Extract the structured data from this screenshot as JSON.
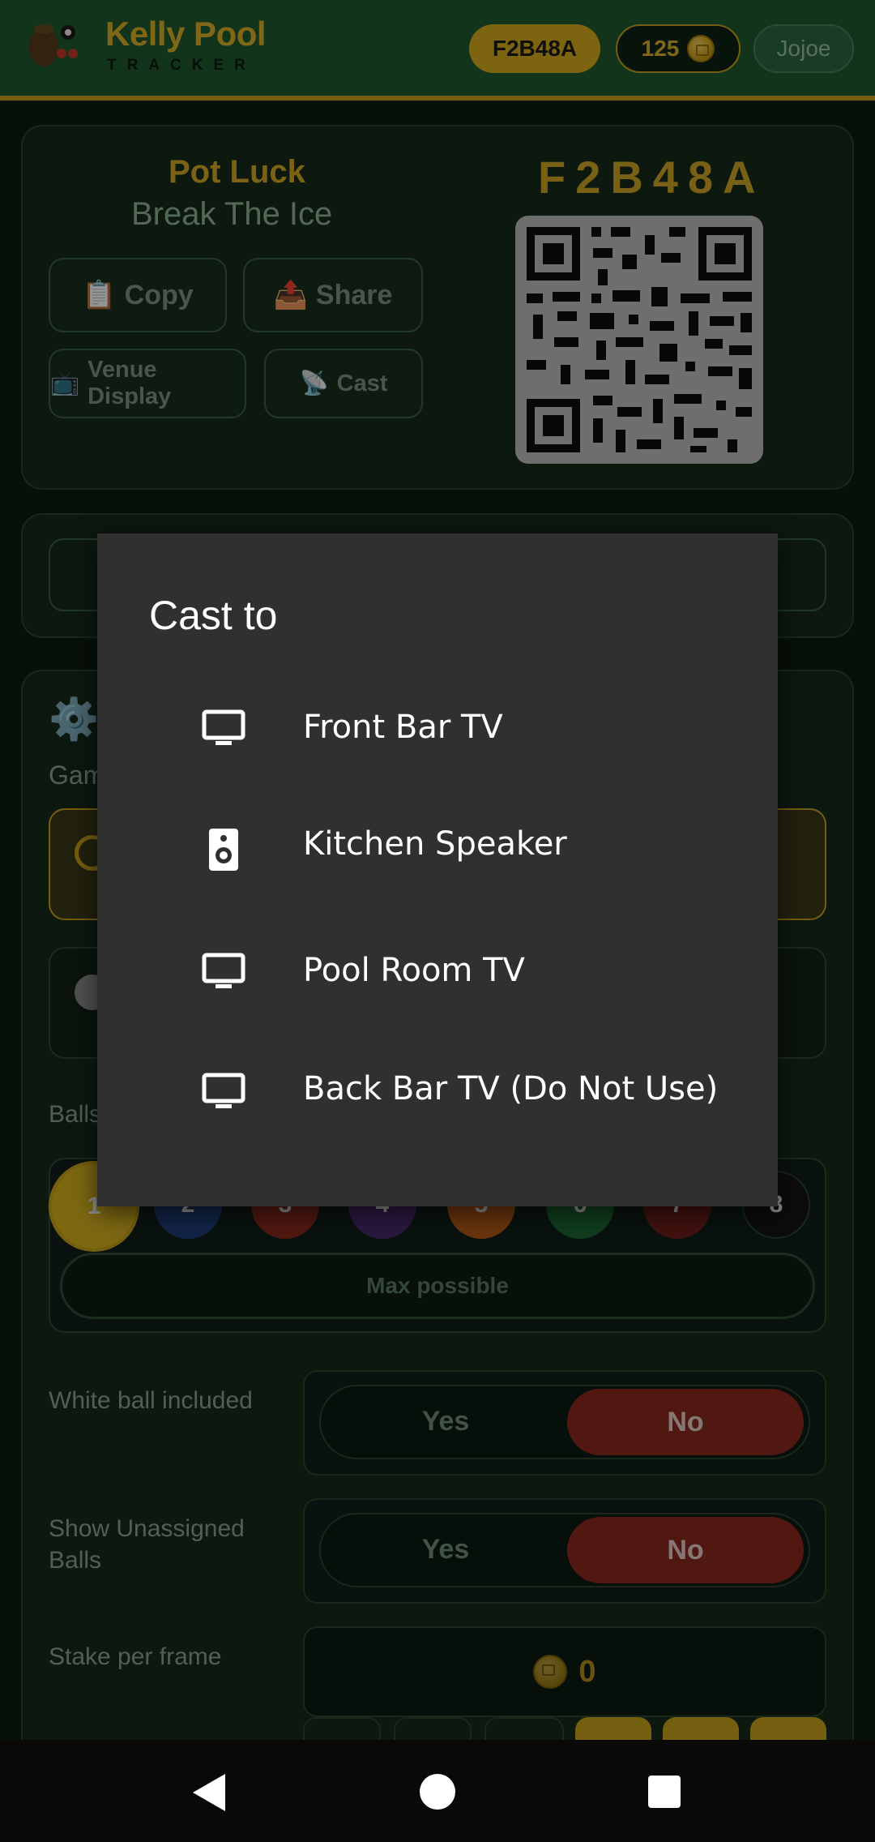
{
  "header": {
    "brand_name": "Kelly Pool",
    "brand_sub": "TRACKER",
    "game_code_pill": "F2B48A",
    "coins": "125",
    "user": "Jojoe"
  },
  "session": {
    "title": "Pot Luck",
    "subtitle": "Break The Ice",
    "copy_label": "Copy",
    "share_label": "Share",
    "venue_label": "Venue Display",
    "cast_label": "Cast",
    "room_code": "F2B48A",
    "icons": {
      "copy": "clipboard-icon",
      "share": "outbox-icon",
      "venue": "tv-icon",
      "cast": "satellite-icon"
    }
  },
  "settings": {
    "game_label_partial": "Gam",
    "balls_label_partial": "Balls",
    "balls": [
      {
        "num": "1",
        "color": "#d8b320"
      },
      {
        "num": "2",
        "color": "#1f3f7a"
      },
      {
        "num": "3",
        "color": "#8a2a1e"
      },
      {
        "num": "4",
        "color": "#4b2a6e"
      },
      {
        "num": "5",
        "color": "#b65a16"
      },
      {
        "num": "6",
        "color": "#1c6a32"
      },
      {
        "num": "7",
        "color": "#6e1f1a"
      },
      {
        "num": "8",
        "color": "#151515"
      }
    ],
    "max_possible": "Max possible",
    "white_ball_label": "White ball included",
    "white_ball_yes": "Yes",
    "white_ball_no": "No",
    "show_unassigned_label_1": "Show Unassigned",
    "show_unassigned_label_2": "Balls",
    "show_unassigned_yes": "Yes",
    "show_unassigned_no": "No",
    "stake_label": "Stake per frame",
    "stake_value": "0"
  },
  "cast_dialog": {
    "title": "Cast to",
    "devices": [
      {
        "label": "Front Bar TV",
        "icon": "tv-icon"
      },
      {
        "label": "Kitchen Speaker",
        "icon": "speaker-icon"
      },
      {
        "label": "Pool Room TV",
        "icon": "tv-icon"
      },
      {
        "label": "Back Bar TV (Do Not Use)",
        "icon": "tv-icon"
      }
    ]
  },
  "colors": {
    "header_green": "#1f5a30",
    "accent_gold": "#c9a21c",
    "dialog_bg": "#303030",
    "no_red": "#8b2a1e"
  }
}
